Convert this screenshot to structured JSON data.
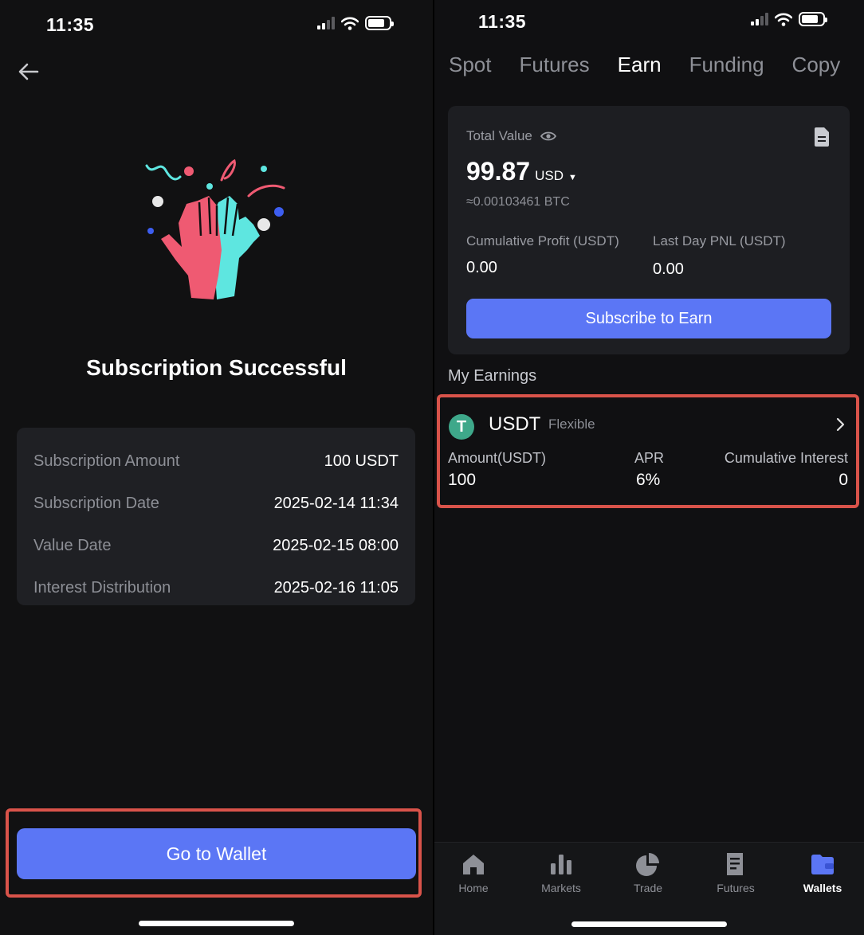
{
  "left_screen": {
    "status": {
      "time": "11:35"
    },
    "title": "Subscription Successful",
    "details": [
      {
        "label": "Subscription Amount",
        "value": "100 USDT"
      },
      {
        "label": "Subscription Date",
        "value": "2025-02-14 11:34"
      },
      {
        "label": "Value Date",
        "value": "2025-02-15 08:00"
      },
      {
        "label": "Interest Distribution",
        "value": "2025-02-16 11:05"
      }
    ],
    "button_label": "Go to Wallet"
  },
  "right_screen": {
    "status": {
      "time": "11:35"
    },
    "tabs": [
      {
        "label": "Spot",
        "active": false
      },
      {
        "label": "Futures",
        "active": false
      },
      {
        "label": "Earn",
        "active": true
      },
      {
        "label": "Funding",
        "active": false
      },
      {
        "label": "Copy",
        "active": false
      }
    ],
    "summary": {
      "total_value_label": "Total Value",
      "total_value": "99.87",
      "currency": "USD",
      "btc_equiv": "≈0.00103461 BTC",
      "cumulative_profit_label": "Cumulative Profit (USDT)",
      "cumulative_profit": "0.00",
      "last_day_pnl_label": "Last Day PNL (USDT)",
      "last_day_pnl": "0.00",
      "subscribe_label": "Subscribe to Earn"
    },
    "my_earnings_label": "My Earnings",
    "earning_item": {
      "coin_glyph": "T",
      "coin": "USDT",
      "type": "Flexible",
      "amount_label": "Amount(USDT)",
      "amount": "100",
      "apr_label": "APR",
      "apr": "6%",
      "interest_label": "Cumulative Interest",
      "interest": "0"
    },
    "bottom_nav": [
      {
        "label": "Home",
        "icon": "home-icon",
        "active": false
      },
      {
        "label": "Markets",
        "icon": "bar-chart-icon",
        "active": false
      },
      {
        "label": "Trade",
        "icon": "pie-chart-icon",
        "active": false
      },
      {
        "label": "Futures",
        "icon": "document-icon",
        "active": false
      },
      {
        "label": "Wallets",
        "icon": "wallet-icon",
        "active": true
      }
    ]
  },
  "colors": {
    "accent": "#5b76f5",
    "highlight": "#d9534a",
    "usdt": "#3ea88a",
    "hand_left": "#ef5a72",
    "hand_right": "#5ee6e0"
  }
}
